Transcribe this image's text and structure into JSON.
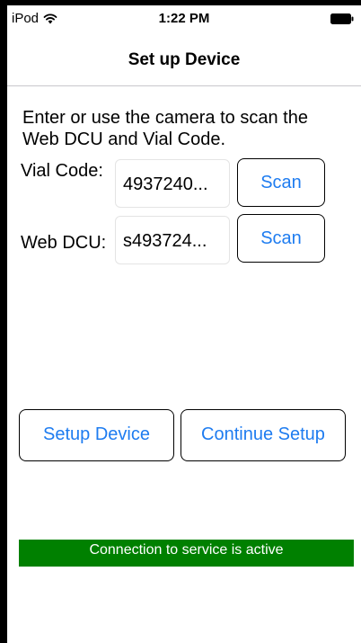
{
  "status_bar": {
    "carrier": "iPod",
    "wifi_icon": "wifi-icon",
    "time": "1:22 PM",
    "battery_icon": "battery-icon"
  },
  "nav": {
    "title": "Set up Device"
  },
  "main": {
    "instructions": "Enter or use the camera to scan the Web DCU and Vial Code.",
    "vial_code": {
      "label": "Vial Code:",
      "value": "4937240...",
      "scan_label": "Scan"
    },
    "web_dcu": {
      "label": "Web DCU:",
      "value": "s493724...",
      "scan_label": "Scan"
    },
    "setup_device_label": "Setup Device",
    "continue_setup_label": "Continue Setup"
  },
  "status": {
    "message": "Connection to service is active",
    "color": "#008000"
  },
  "colors": {
    "accent": "#1e7cf0",
    "background": "#ffffff",
    "frame": "#000000"
  }
}
